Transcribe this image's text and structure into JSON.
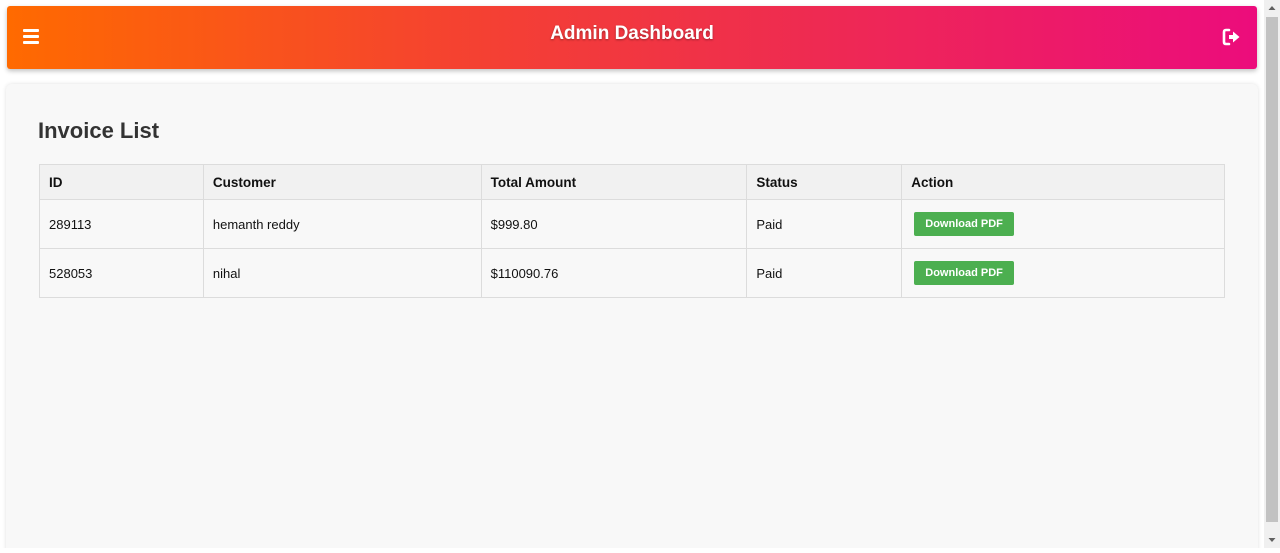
{
  "header": {
    "title": "Admin Dashboard",
    "menu_icon": "hamburger-menu-icon",
    "logout_icon": "sign-out-icon",
    "gradient_start": "#ff6a00",
    "gradient_end": "#ec0c7c"
  },
  "invoices": {
    "title": "Invoice List",
    "columns": [
      "ID",
      "Customer",
      "Total Amount",
      "Status",
      "Action"
    ],
    "rows": [
      {
        "id": "289113",
        "customer": "hemanth reddy",
        "total": "$999.80",
        "status": "Paid",
        "action": "Download PDF"
      },
      {
        "id": "528053",
        "customer": "nihal",
        "total": "$110090.76",
        "status": "Paid",
        "action": "Download PDF"
      }
    ],
    "button_color": "#4caf50"
  }
}
